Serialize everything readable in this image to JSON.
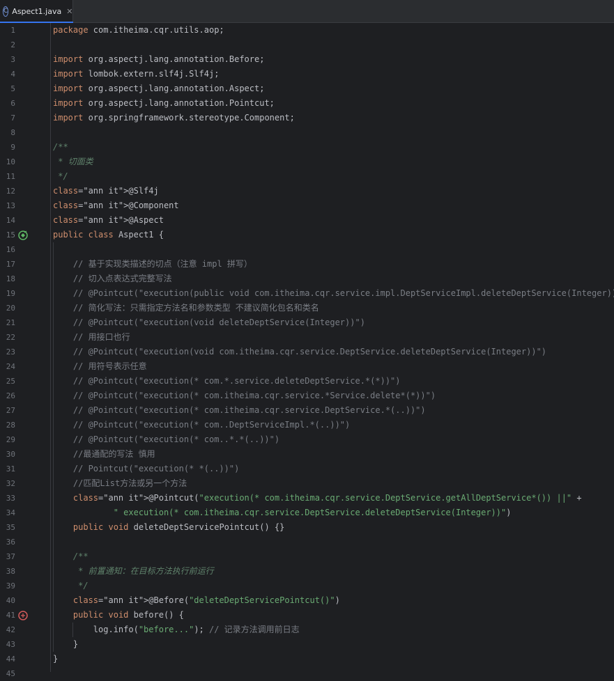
{
  "tab": {
    "filename": "Aspect1.java",
    "close_glyph": "✕",
    "file_icon_letter": "C"
  },
  "lines": [
    {
      "n": "1",
      "t": "package com.itheima.cqr.utils.aop;"
    },
    {
      "n": "2",
      "t": ""
    },
    {
      "n": "3",
      "t": "import org.aspectj.lang.annotation.Before;"
    },
    {
      "n": "4",
      "t": "import lombok.extern.slf4j.Slf4j;"
    },
    {
      "n": "5",
      "t": "import org.aspectj.lang.annotation.Aspect;"
    },
    {
      "n": "6",
      "t": "import org.aspectj.lang.annotation.Pointcut;"
    },
    {
      "n": "7",
      "t": "import org.springframework.stereotype.Component;"
    },
    {
      "n": "8",
      "t": ""
    },
    {
      "n": "9",
      "t": "/**"
    },
    {
      "n": "10",
      "t": " * 切面类"
    },
    {
      "n": "11",
      "t": " */"
    },
    {
      "n": "12",
      "t": "@Slf4j"
    },
    {
      "n": "13",
      "t": "@Component"
    },
    {
      "n": "14",
      "t": "@Aspect"
    },
    {
      "n": "15",
      "t": "public class Aspect1 {"
    },
    {
      "n": "16",
      "t": ""
    },
    {
      "n": "17",
      "t": "    // 基于实现类描述的切点（注意 impl 拼写）"
    },
    {
      "n": "18",
      "t": "    // 切入点表达式完整写法"
    },
    {
      "n": "19",
      "t": "    // @Pointcut(\"execution(public void com.itheima.cqr.service.impl.DeptServiceImpl.deleteDeptService(Integer))\")"
    },
    {
      "n": "20",
      "t": "    // 简化写法：只需指定方法名和参数类型 不建议简化包名和类名"
    },
    {
      "n": "21",
      "t": "    // @Pointcut(\"execution(void deleteDeptService(Integer))\")"
    },
    {
      "n": "22",
      "t": "    // 用接口也行"
    },
    {
      "n": "23",
      "t": "    // @Pointcut(\"execution(void com.itheima.cqr.service.DeptService.deleteDeptService(Integer))\")"
    },
    {
      "n": "24",
      "t": "    // 用符号表示任意"
    },
    {
      "n": "25",
      "t": "    // @Pointcut(\"execution(* com.*.service.deleteDeptService.*(*))\")"
    },
    {
      "n": "26",
      "t": "    // @Pointcut(\"execution(* com.itheima.cqr.service.*Service.delete*(*))\")"
    },
    {
      "n": "27",
      "t": "    // @Pointcut(\"execution(* com.itheima.cqr.service.DeptService.*(..))\")"
    },
    {
      "n": "28",
      "t": "    // @Pointcut(\"execution(* com..DeptServiceImpl.*(..))\")"
    },
    {
      "n": "29",
      "t": "    // @Pointcut(\"execution(* com..*.*(..))\")"
    },
    {
      "n": "30",
      "t": "    //最通配的写法 慎用"
    },
    {
      "n": "31",
      "t": "    // Pointcut(\"execution(* *(..))\")"
    },
    {
      "n": "32",
      "t": "    //匹配List方法或另一个方法"
    },
    {
      "n": "33",
      "t": "    @Pointcut(\"execution(* com.itheima.cqr.service.DeptService.getAllDeptService*()) ||\" +"
    },
    {
      "n": "34",
      "t": "            \" execution(* com.itheima.cqr.service.DeptService.deleteDeptService(Integer))\")"
    },
    {
      "n": "35",
      "t": "    public void deleteDeptServicePointcut() {}"
    },
    {
      "n": "36",
      "t": ""
    },
    {
      "n": "37",
      "t": "    /**"
    },
    {
      "n": "38",
      "t": "     * 前置通知：在目标方法执行前运行"
    },
    {
      "n": "39",
      "t": "     */"
    },
    {
      "n": "40",
      "t": "    @Before(\"deleteDeptServicePointcut()\")"
    },
    {
      "n": "41",
      "t": "    public void before() {"
    },
    {
      "n": "42",
      "t": "        log.info(\"before...\"); // 记录方法调用前日志"
    },
    {
      "n": "43",
      "t": "    }"
    },
    {
      "n": "44",
      "t": "}"
    },
    {
      "n": "45",
      "t": ""
    }
  ],
  "gutter_icons": {
    "15": "aspect-bean-icon",
    "41": "advice-icon"
  },
  "colors": {
    "background": "#1e1f22",
    "keyword": "#cf8e6d",
    "annotation": "#b3ae60",
    "string": "#6aab73",
    "comment": "#7a7e85",
    "doc_comment": "#5f826b",
    "tab_accent": "#3574f0"
  }
}
